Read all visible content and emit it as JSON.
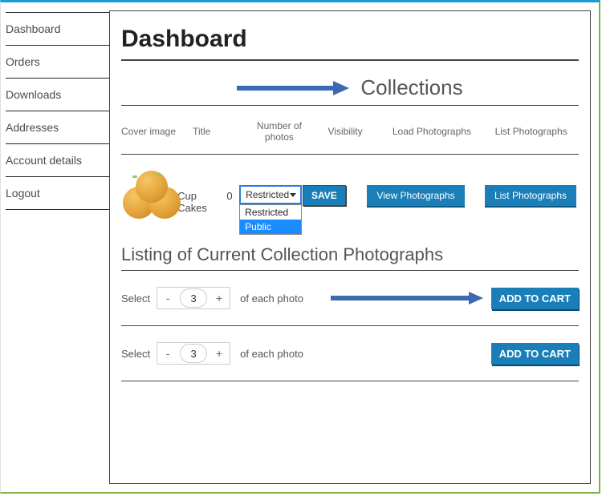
{
  "sidebar": {
    "items": [
      {
        "label": "Dashboard"
      },
      {
        "label": "Orders"
      },
      {
        "label": "Downloads"
      },
      {
        "label": "Addresses"
      },
      {
        "label": "Account details"
      },
      {
        "label": "Logout"
      }
    ]
  },
  "page": {
    "title": "Dashboard"
  },
  "collections_section": {
    "title": "Collections",
    "columns": {
      "cover": "Cover image",
      "title": "Title",
      "num": "Number of photos",
      "vis": "Visibility",
      "load": "Load Photographs",
      "list": "List Photographs"
    },
    "row": {
      "title": "Cup Cakes",
      "num_photos": "0",
      "visibility_selected": "Restricted",
      "visibility_options": [
        "Restricted",
        "Public"
      ],
      "save_label": "SAVE",
      "view_btn": "View Photographs",
      "list_btn": "List Photographs"
    }
  },
  "listing_section": {
    "title": "Listing of Current Collection Photographs",
    "rows": [
      {
        "select_label": "Select",
        "qty": "3",
        "of_each": "of each photo",
        "add_to_cart": "ADD TO CART"
      },
      {
        "select_label": "Select",
        "qty": "3",
        "of_each": "of each photo",
        "add_to_cart": "ADD TO CART"
      }
    ]
  }
}
